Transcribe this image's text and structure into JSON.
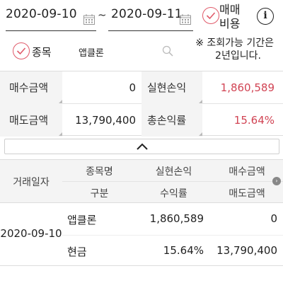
{
  "filter": {
    "start_date": "2020-09-10",
    "separator": "~",
    "end_date": "2020-09-11",
    "fee_toggle_line1": "매매",
    "fee_toggle_line2": "비용",
    "info_glyph": "i",
    "stock_label": "종목",
    "stock_value": "앱클론",
    "notice_line1": "※ 조회가능 기간은",
    "notice_line2": "2년입니다."
  },
  "summary": {
    "buy_amount_label": "매수금액",
    "buy_amount_value": "0",
    "realized_pl_label": "실현손익",
    "realized_pl_value": "1,860,589",
    "sell_amount_label": "매도금액",
    "sell_amount_value": "13,790,400",
    "total_return_label": "총손익률",
    "total_return_value": "15.64%"
  },
  "table": {
    "headers": {
      "trade_date": "거래일자",
      "stock_name": "종목명",
      "category": "구분",
      "realized_pl": "실현손익",
      "return_rate": "수익률",
      "buy_amount": "매수금액",
      "sell_amount": "매도금액"
    },
    "rows": [
      {
        "trade_date": "2020-09-10",
        "stock_name": "앱클론",
        "realized_pl": "1,860,589",
        "buy_amount": "0",
        "category": "현금",
        "return_rate": "15.64%",
        "sell_amount": "13,790,400"
      }
    ]
  },
  "colors": {
    "accent_red": "#d14454",
    "header_bg": "#f4f4f4"
  },
  "icons": [
    "calendar-icon",
    "check-icon",
    "info-icon",
    "search-icon",
    "chevron-up-icon",
    "scroll-indicator-icon"
  ]
}
